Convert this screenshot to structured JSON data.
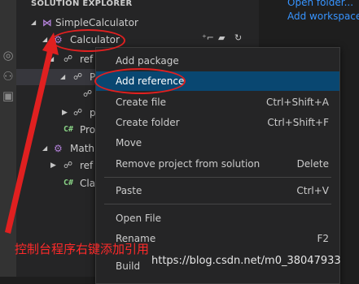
{
  "explorer": {
    "title": "SOLUTION EXPLORER",
    "items": [
      {
        "label": "SimpleCalculator",
        "icon": "visual-studio-icon"
      },
      {
        "label": "Calculator",
        "icon": "csharp-project-icon"
      },
      {
        "label": "ref",
        "icon": "references-icon"
      },
      {
        "label": "P",
        "icon": "references-icon"
      },
      {
        "label": "",
        "icon": "references-icon"
      },
      {
        "label": "p",
        "icon": "references-icon"
      },
      {
        "label": "Pro",
        "icon": "csharp-file-icon"
      },
      {
        "label": "Math",
        "icon": "csharp-project-icon"
      },
      {
        "label": "ref",
        "icon": "references-icon"
      },
      {
        "label": "Cla",
        "icon": "csharp-file-icon"
      }
    ]
  },
  "welcome": {
    "open_folder": "Open folder...",
    "add_workspace": "Add workspace"
  },
  "context_menu": {
    "items": [
      {
        "label": "Add package",
        "shortcut": ""
      },
      {
        "label": "Add reference",
        "shortcut": ""
      },
      {
        "label": "Create file",
        "shortcut": "Ctrl+Shift+A"
      },
      {
        "label": "Create folder",
        "shortcut": "Ctrl+Shift+F"
      },
      {
        "label": "Move",
        "shortcut": ""
      },
      {
        "label": "Remove project from solution",
        "shortcut": "Delete"
      },
      {
        "label": "Paste",
        "shortcut": "Ctrl+V"
      },
      {
        "label": "Open File",
        "shortcut": ""
      },
      {
        "label": "Rename",
        "shortcut": "F2"
      },
      {
        "label": "Build",
        "shortcut": ""
      }
    ]
  },
  "annotation": {
    "text": "控制台程序右键添加引用",
    "color": "#ff2a2a"
  },
  "watermark": "https://blog.csdn.net/m0_38047933",
  "colors": {
    "highlight": "#094771",
    "annotation_red": "#e02020"
  }
}
